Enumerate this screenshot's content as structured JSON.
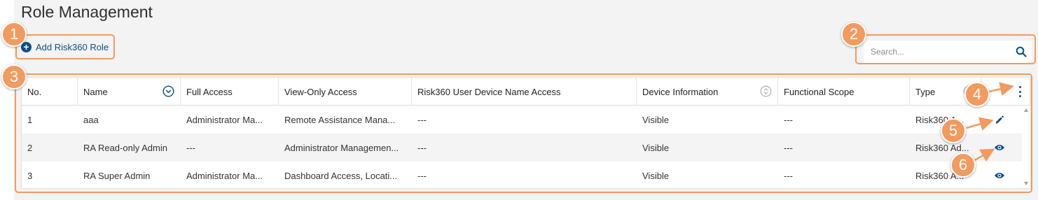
{
  "page": {
    "title": "Role Management"
  },
  "toolbar": {
    "add_role_label": "Add Risk360 Role",
    "add_icon": "+"
  },
  "search": {
    "placeholder": "Search..."
  },
  "table": {
    "columns": [
      {
        "key": "no",
        "label": "No."
      },
      {
        "key": "name",
        "label": "Name"
      },
      {
        "key": "full",
        "label": "Full Access"
      },
      {
        "key": "view",
        "label": "View-Only Access"
      },
      {
        "key": "device_name",
        "label": "Risk360 User Device Name Access"
      },
      {
        "key": "device_info",
        "label": "Device Information"
      },
      {
        "key": "scope",
        "label": "Functional Scope"
      },
      {
        "key": "type",
        "label": "Type"
      }
    ],
    "rows": [
      {
        "no": "1",
        "name": "aaa",
        "full": "Administrator Ma...",
        "view": "Remote Assistance Mana...",
        "device_name": "---",
        "device_info": "Visible",
        "scope": "---",
        "type": "Risk360 A...",
        "action": "edit"
      },
      {
        "no": "2",
        "name": "RA Read-only Admin",
        "full": "---",
        "view": "Administrator Managemen...",
        "device_name": "---",
        "device_info": "Visible",
        "scope": "---",
        "type": "Risk360 Ad...",
        "action": "view"
      },
      {
        "no": "3",
        "name": "RA Super Admin",
        "full": "Administrator Ma...",
        "view": "Dashboard Access, Locati...",
        "device_name": "---",
        "device_info": "Visible",
        "scope": "---",
        "type": "Risk360 A...",
        "action": "view"
      }
    ]
  },
  "callouts": [
    "1",
    "2",
    "3",
    "4",
    "5",
    "6"
  ],
  "icons": {
    "name_sort": "chevron-down-circle-icon",
    "device_sort": "sort-circle-icon",
    "type_sort": "sort-circle-icon",
    "search": "search-icon",
    "kebab": "kebab-menu-icon",
    "edit": "pencil-icon",
    "view": "eye-icon"
  },
  "colors": {
    "accent": "#0b4f87",
    "callout": "#f39a5f",
    "background": "#f3f3f3"
  }
}
